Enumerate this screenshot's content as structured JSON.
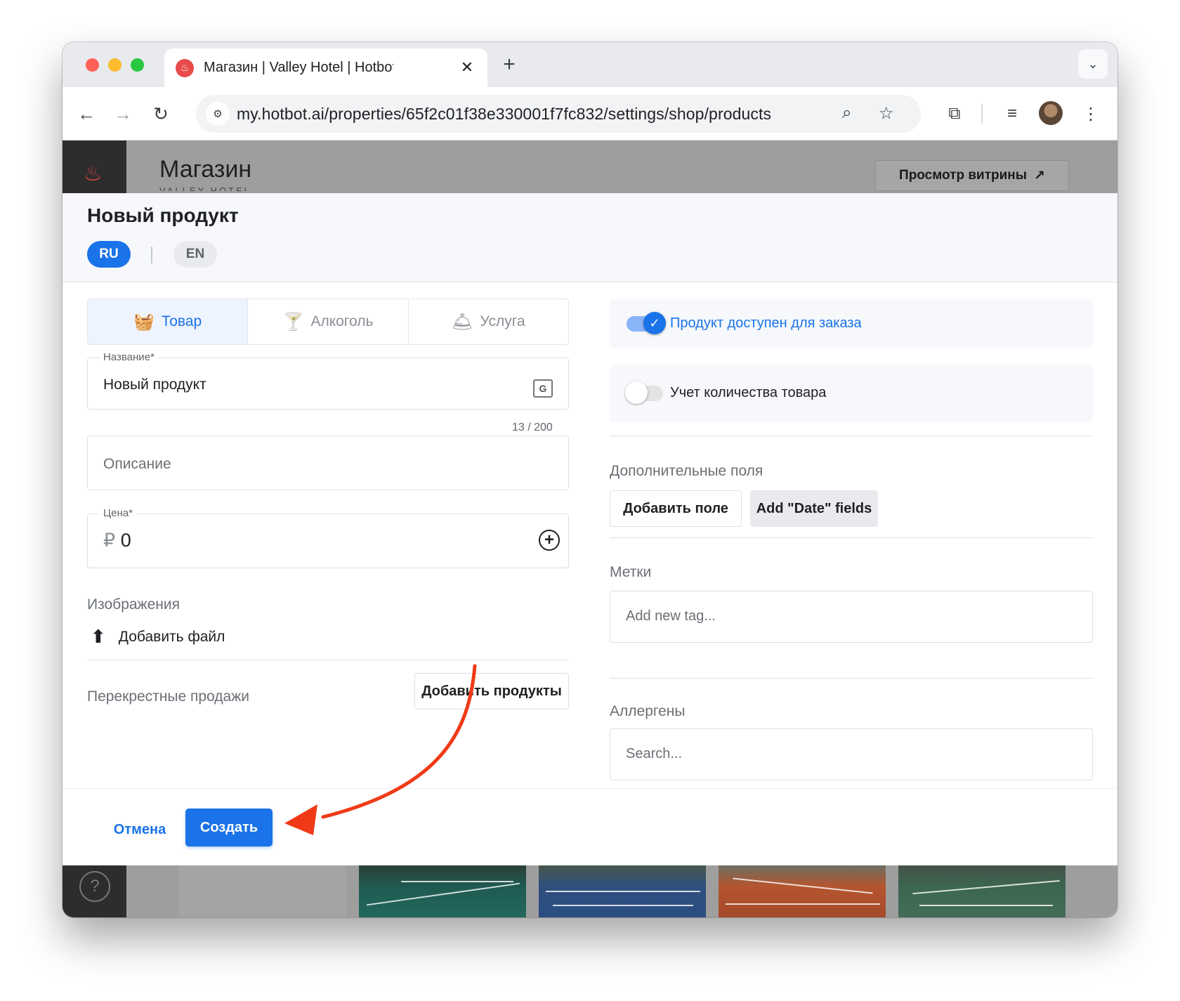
{
  "browser": {
    "tab_title": "Магазин | Valley Hotel | Hotbot",
    "url": "my.hotbot.ai/properties/65f2c01f38e330001f7fc832/settings/shop/products"
  },
  "page": {
    "title": "Магазин",
    "subtitle": "VALLEY HOTEL",
    "storefront_button": "Просмотр витрины"
  },
  "modal": {
    "title": "Новый продукт",
    "languages": [
      "RU",
      "EN"
    ],
    "active_language": "RU",
    "type_tabs": [
      "Товар",
      "Алкоголь",
      "Услуга"
    ],
    "active_type": "Товар",
    "name_field": {
      "label": "Название*",
      "value": "Новый продукт",
      "counter": "13 / 200"
    },
    "description_field": {
      "placeholder": "Описание"
    },
    "price_field": {
      "label": "Цена*",
      "currency": "₽",
      "value": "0"
    },
    "images": {
      "label": "Изображения",
      "add_file": "Добавить файл"
    },
    "cross_sell": {
      "label": "Перекрестные продажи",
      "button": "Добавить продукты"
    },
    "available_toggle": {
      "label": "Продукт доступен для заказа",
      "on": true
    },
    "stock_toggle": {
      "label": "Учет количества товара",
      "on": false
    },
    "extra_fields": {
      "label": "Дополнительные поля",
      "add_field": "Добавить поле",
      "add_date": "Add \"Date\" fields"
    },
    "tags": {
      "label": "Метки",
      "placeholder": "Add new tag..."
    },
    "allergens": {
      "label": "Аллергены",
      "placeholder": "Search..."
    },
    "footer": {
      "cancel": "Отмена",
      "create": "Создать"
    }
  },
  "colors": {
    "primary": "#1a73e8",
    "annotation_arrow": "#f03a17"
  }
}
